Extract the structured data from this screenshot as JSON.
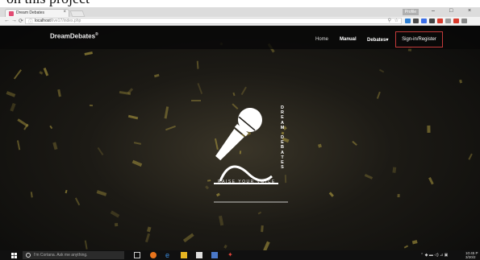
{
  "caption": {
    "text": "on this project"
  },
  "browser": {
    "tab_title": "Dream Debates",
    "tab_close": "×",
    "profile": "Profile",
    "window_controls": [
      "–",
      "□",
      "×"
    ],
    "url_host": "localhost",
    "url_path": "/live17/index.php",
    "nav_icons": [
      "back-arrow-icon",
      "forward-arrow-icon",
      "reload-icon"
    ],
    "extension_colors": [
      "#2d7fd3",
      "#4a4a4a",
      "#3a6ee8",
      "#444444",
      "#d83a2c",
      "#9a9a9a",
      "#d83a2c",
      "#888888"
    ]
  },
  "navbar": {
    "brand": "DreamDebates",
    "brand_mark": "®",
    "links": {
      "home": "Home",
      "manual": "Manual",
      "debates": "Debates",
      "debates_caret": "▾"
    },
    "signin": "Sign-in/Register",
    "signin_border_color": "#c23a3a"
  },
  "hero": {
    "vertical_text": [
      "D",
      "R",
      "E",
      "A",
      "M",
      "",
      "D",
      "E",
      "B",
      "A",
      "T",
      "E",
      "S"
    ],
    "tagline": "RAISE YOUR VOICE"
  },
  "taskbar": {
    "cortana_placeholder": "I'm Cortana. Ask me anything.",
    "clock_time": "10:45 P",
    "clock_date": "3/20/2"
  }
}
